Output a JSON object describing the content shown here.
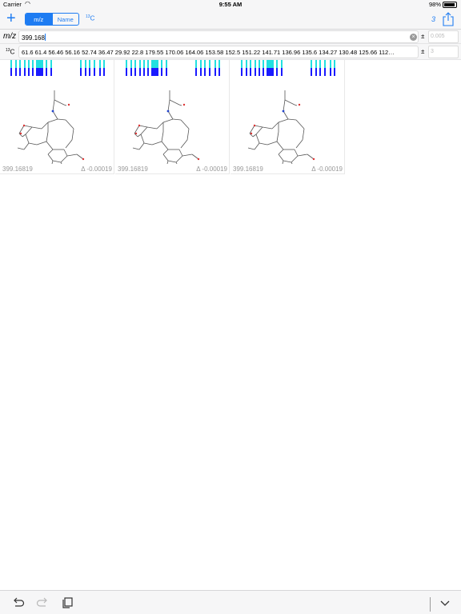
{
  "status": {
    "carrier": "Carrier",
    "time": "9:55 AM",
    "battery": "98%"
  },
  "nav": {
    "segments": [
      "m/z",
      "Name"
    ],
    "c13_mass": "13",
    "c13_letter": "C",
    "result_count": "3"
  },
  "mz": {
    "label": "m/z",
    "value": "399.168",
    "pm": "±",
    "tolerance_placeholder": "0.005"
  },
  "c13": {
    "mass": "13",
    "letter": "C",
    "shifts": "61.6 61.4 56.46 56.16 52.74 36.47 29.92 22.8 179.55 170.06 164.06 153.58 152.5 151.22 141.71 136.96 135.6 134.27 130.48 125.66 112…",
    "pm": "±",
    "tolerance_placeholder": "3"
  },
  "results": [
    {
      "mass": "399.16819",
      "delta": "Δ -0.00019"
    },
    {
      "mass": "399.16819",
      "delta": "Δ -0.00019"
    },
    {
      "mass": "399.16819",
      "delta": "Δ -0.00019"
    }
  ],
  "colors": {
    "accent": "#1e7cf2",
    "match": "#1a1aff",
    "candidate": "#22e0e0"
  },
  "icons": [
    "plus-icon",
    "share-icon",
    "clear-icon",
    "undo-icon",
    "redo-icon",
    "copy-icon",
    "chevron-down-icon"
  ]
}
